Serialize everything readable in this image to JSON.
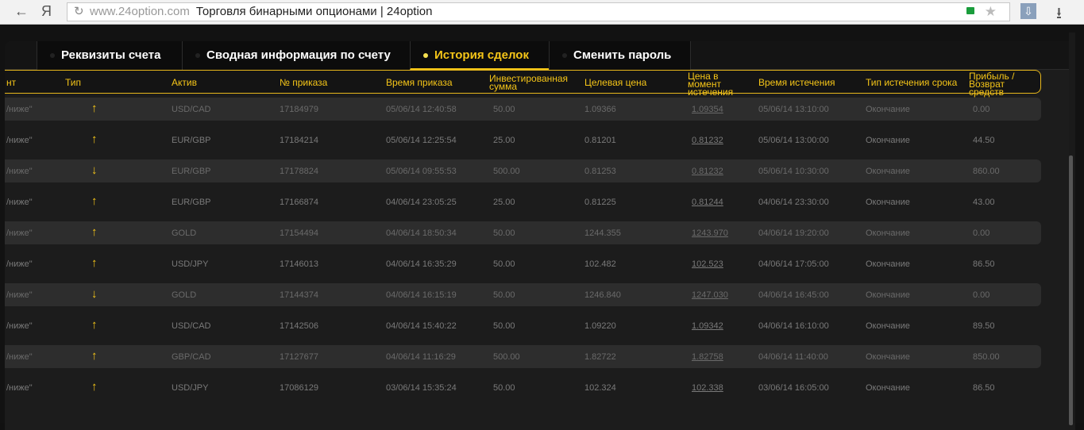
{
  "browser": {
    "back": "←",
    "yandex": "Я",
    "reload": "↻",
    "url": "www.24option.com",
    "title": "Торговля бинарными опционами | 24option",
    "star": "★",
    "download": "⇩",
    "save": "⭳"
  },
  "tabs": [
    {
      "label": "Реквизиты счета"
    },
    {
      "label": "Сводная информация по счету"
    },
    {
      "label": "История сделок",
      "active": true
    },
    {
      "label": "Сменить пароль"
    }
  ],
  "columns": {
    "c0": "нт",
    "type": "Тип",
    "asset": "Актив",
    "order": "№ приказа",
    "time": "Время приказа",
    "invest": "Инвестированная сумма",
    "target": "Целевая цена",
    "expiry_price": "Цена в момент истечения",
    "expiry_time": "Время истечения",
    "expiry_type": "Тип истечения срока",
    "profit": "Прибыль / Возврат средств"
  },
  "rows": [
    {
      "c0": "/ниже\"",
      "dir": "up",
      "arrow": "↑",
      "asset": "USD/CAD",
      "order": "17184979",
      "time": "05/06/14 12:40:58",
      "invest": "50.00",
      "target": "1.09366",
      "expiry_price": "1.09354",
      "expiry_time": "05/06/14 13:10:00",
      "expiry_type": "Окончание",
      "profit": "0.00"
    },
    {
      "c0": "/ниже\"",
      "dir": "up",
      "arrow": "↑",
      "asset": "EUR/GBP",
      "order": "17184214",
      "time": "05/06/14 12:25:54",
      "invest": "25.00",
      "target": "0.81201",
      "expiry_price": "0.81232",
      "expiry_time": "05/06/14 13:00:00",
      "expiry_type": "Окончание",
      "profit": "44.50"
    },
    {
      "c0": "/ниже\"",
      "dir": "down",
      "arrow": "↓",
      "asset": "EUR/GBP",
      "order": "17178824",
      "time": "05/06/14 09:55:53",
      "invest": "500.00",
      "target": "0.81253",
      "expiry_price": "0.81232",
      "expiry_time": "05/06/14 10:30:00",
      "expiry_type": "Окончание",
      "profit": "860.00"
    },
    {
      "c0": "/ниже\"",
      "dir": "up",
      "arrow": "↑",
      "asset": "EUR/GBP",
      "order": "17166874",
      "time": "04/06/14 23:05:25",
      "invest": "25.00",
      "target": "0.81225",
      "expiry_price": "0.81244",
      "expiry_time": "04/06/14 23:30:00",
      "expiry_type": "Окончание",
      "profit": "43.00"
    },
    {
      "c0": "/ниже\"",
      "dir": "up",
      "arrow": "↑",
      "asset": "GOLD",
      "order": "17154494",
      "time": "04/06/14 18:50:34",
      "invest": "50.00",
      "target": "1244.355",
      "expiry_price": "1243.970",
      "expiry_time": "04/06/14 19:20:00",
      "expiry_type": "Окончание",
      "profit": "0.00"
    },
    {
      "c0": "/ниже\"",
      "dir": "up",
      "arrow": "↑",
      "asset": "USD/JPY",
      "order": "17146013",
      "time": "04/06/14 16:35:29",
      "invest": "50.00",
      "target": "102.482",
      "expiry_price": "102.523",
      "expiry_time": "04/06/14 17:05:00",
      "expiry_type": "Окончание",
      "profit": "86.50"
    },
    {
      "c0": "/ниже\"",
      "dir": "down",
      "arrow": "↓",
      "asset": "GOLD",
      "order": "17144374",
      "time": "04/06/14 16:15:19",
      "invest": "50.00",
      "target": "1246.840",
      "expiry_price": "1247.030",
      "expiry_time": "04/06/14 16:45:00",
      "expiry_type": "Окончание",
      "profit": "0.00"
    },
    {
      "c0": "/ниже\"",
      "dir": "up",
      "arrow": "↑",
      "asset": "USD/CAD",
      "order": "17142506",
      "time": "04/06/14 15:40:22",
      "invest": "50.00",
      "target": "1.09220",
      "expiry_price": "1.09342",
      "expiry_time": "04/06/14 16:10:00",
      "expiry_type": "Окончание",
      "profit": "89.50"
    },
    {
      "c0": "/ниже\"",
      "dir": "up",
      "arrow": "↑",
      "asset": "GBP/CAD",
      "order": "17127677",
      "time": "04/06/14 11:16:29",
      "invest": "500.00",
      "target": "1.82722",
      "expiry_price": "1.82758",
      "expiry_time": "04/06/14 11:40:00",
      "expiry_type": "Окончание",
      "profit": "850.00"
    },
    {
      "c0": "/ниже\"",
      "dir": "up",
      "arrow": "↑",
      "asset": "USD/JPY",
      "order": "17086129",
      "time": "03/06/14 15:35:24",
      "invest": "50.00",
      "target": "102.324",
      "expiry_price": "102.338",
      "expiry_time": "03/06/14 16:05:00",
      "expiry_type": "Окончание",
      "profit": "86.50"
    }
  ]
}
